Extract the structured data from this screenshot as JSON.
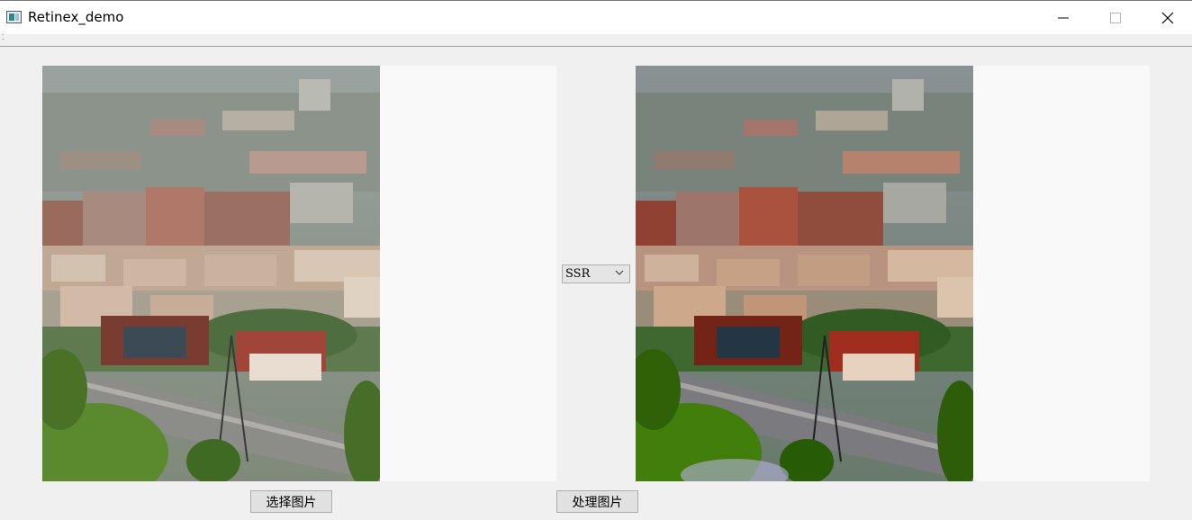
{
  "window": {
    "title": "Retinex_demo",
    "icon": "app-window-icon"
  },
  "titlebar_buttons": [
    "minimize-icon",
    "maximize-icon",
    "close-icon"
  ],
  "images": {
    "original": {
      "label": "original-image",
      "description_visible": false
    },
    "processed": {
      "label": "processed-image",
      "description_visible": false
    }
  },
  "method_select": {
    "selected": "SSR"
  },
  "buttons": {
    "select_image": "选择图片",
    "process_image": "处理图片"
  },
  "colors": {
    "titlebar_bg": "#ffffff",
    "window_bg": "#f0f0f0",
    "panel_bg": "#f9f9f9",
    "button_bg": "#e1e1e1",
    "button_border": "#adadad"
  }
}
